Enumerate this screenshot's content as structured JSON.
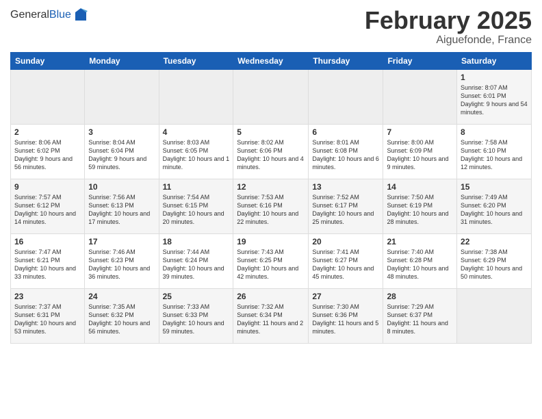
{
  "header": {
    "logo_general": "General",
    "logo_blue": "Blue",
    "month_title": "February 2025",
    "location": "Aiguefonde, France"
  },
  "days_of_week": [
    "Sunday",
    "Monday",
    "Tuesday",
    "Wednesday",
    "Thursday",
    "Friday",
    "Saturday"
  ],
  "weeks": [
    [
      {
        "day": "",
        "info": ""
      },
      {
        "day": "",
        "info": ""
      },
      {
        "day": "",
        "info": ""
      },
      {
        "day": "",
        "info": ""
      },
      {
        "day": "",
        "info": ""
      },
      {
        "day": "",
        "info": ""
      },
      {
        "day": "1",
        "info": "Sunrise: 8:07 AM\nSunset: 6:01 PM\nDaylight: 9 hours and 54 minutes."
      }
    ],
    [
      {
        "day": "2",
        "info": "Sunrise: 8:06 AM\nSunset: 6:02 PM\nDaylight: 9 hours and 56 minutes."
      },
      {
        "day": "3",
        "info": "Sunrise: 8:04 AM\nSunset: 6:04 PM\nDaylight: 9 hours and 59 minutes."
      },
      {
        "day": "4",
        "info": "Sunrise: 8:03 AM\nSunset: 6:05 PM\nDaylight: 10 hours and 1 minute."
      },
      {
        "day": "5",
        "info": "Sunrise: 8:02 AM\nSunset: 6:06 PM\nDaylight: 10 hours and 4 minutes."
      },
      {
        "day": "6",
        "info": "Sunrise: 8:01 AM\nSunset: 6:08 PM\nDaylight: 10 hours and 6 minutes."
      },
      {
        "day": "7",
        "info": "Sunrise: 8:00 AM\nSunset: 6:09 PM\nDaylight: 10 hours and 9 minutes."
      },
      {
        "day": "8",
        "info": "Sunrise: 7:58 AM\nSunset: 6:10 PM\nDaylight: 10 hours and 12 minutes."
      }
    ],
    [
      {
        "day": "9",
        "info": "Sunrise: 7:57 AM\nSunset: 6:12 PM\nDaylight: 10 hours and 14 minutes."
      },
      {
        "day": "10",
        "info": "Sunrise: 7:56 AM\nSunset: 6:13 PM\nDaylight: 10 hours and 17 minutes."
      },
      {
        "day": "11",
        "info": "Sunrise: 7:54 AM\nSunset: 6:15 PM\nDaylight: 10 hours and 20 minutes."
      },
      {
        "day": "12",
        "info": "Sunrise: 7:53 AM\nSunset: 6:16 PM\nDaylight: 10 hours and 22 minutes."
      },
      {
        "day": "13",
        "info": "Sunrise: 7:52 AM\nSunset: 6:17 PM\nDaylight: 10 hours and 25 minutes."
      },
      {
        "day": "14",
        "info": "Sunrise: 7:50 AM\nSunset: 6:19 PM\nDaylight: 10 hours and 28 minutes."
      },
      {
        "day": "15",
        "info": "Sunrise: 7:49 AM\nSunset: 6:20 PM\nDaylight: 10 hours and 31 minutes."
      }
    ],
    [
      {
        "day": "16",
        "info": "Sunrise: 7:47 AM\nSunset: 6:21 PM\nDaylight: 10 hours and 33 minutes."
      },
      {
        "day": "17",
        "info": "Sunrise: 7:46 AM\nSunset: 6:23 PM\nDaylight: 10 hours and 36 minutes."
      },
      {
        "day": "18",
        "info": "Sunrise: 7:44 AM\nSunset: 6:24 PM\nDaylight: 10 hours and 39 minutes."
      },
      {
        "day": "19",
        "info": "Sunrise: 7:43 AM\nSunset: 6:25 PM\nDaylight: 10 hours and 42 minutes."
      },
      {
        "day": "20",
        "info": "Sunrise: 7:41 AM\nSunset: 6:27 PM\nDaylight: 10 hours and 45 minutes."
      },
      {
        "day": "21",
        "info": "Sunrise: 7:40 AM\nSunset: 6:28 PM\nDaylight: 10 hours and 48 minutes."
      },
      {
        "day": "22",
        "info": "Sunrise: 7:38 AM\nSunset: 6:29 PM\nDaylight: 10 hours and 50 minutes."
      }
    ],
    [
      {
        "day": "23",
        "info": "Sunrise: 7:37 AM\nSunset: 6:31 PM\nDaylight: 10 hours and 53 minutes."
      },
      {
        "day": "24",
        "info": "Sunrise: 7:35 AM\nSunset: 6:32 PM\nDaylight: 10 hours and 56 minutes."
      },
      {
        "day": "25",
        "info": "Sunrise: 7:33 AM\nSunset: 6:33 PM\nDaylight: 10 hours and 59 minutes."
      },
      {
        "day": "26",
        "info": "Sunrise: 7:32 AM\nSunset: 6:34 PM\nDaylight: 11 hours and 2 minutes."
      },
      {
        "day": "27",
        "info": "Sunrise: 7:30 AM\nSunset: 6:36 PM\nDaylight: 11 hours and 5 minutes."
      },
      {
        "day": "28",
        "info": "Sunrise: 7:29 AM\nSunset: 6:37 PM\nDaylight: 11 hours and 8 minutes."
      },
      {
        "day": "",
        "info": ""
      }
    ]
  ]
}
